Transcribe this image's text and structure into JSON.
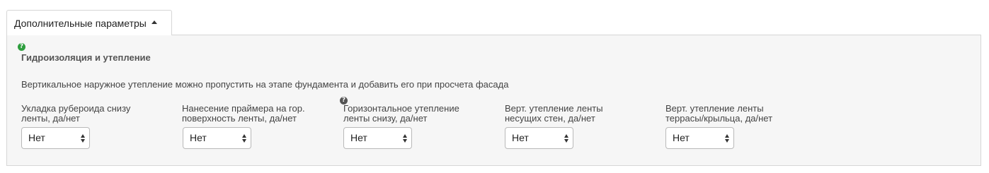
{
  "tab": {
    "label": "Дополнительные параметры"
  },
  "section": {
    "title": "Гидроизоляция и утепление",
    "help_glyph": "?",
    "note": "Вертикальное наружное утепление можно пропустить на этапе фундамента и добавить его при просчета фасада"
  },
  "fields": [
    {
      "label": "Укладка рубероида снизу ленты, да/нет",
      "value": "Нет"
    },
    {
      "label": "Нанесение праймера на гор. поверхность ленты, да/нет",
      "value": "Нет"
    },
    {
      "label": "Горизонтальное утепление ленты снизу, да/нет",
      "value": "Нет",
      "help_glyph": "?"
    },
    {
      "label": "Верт. утепление ленты несущих стен, да/нет",
      "value": "Нет"
    },
    {
      "label": "Верт. утепление ленты террасы/крыльца, да/нет",
      "value": "Нет"
    }
  ],
  "colors": {
    "help_green": "#2e9e3e",
    "panel_bg": "#f6f6f6",
    "border": "#d6d6d6"
  }
}
